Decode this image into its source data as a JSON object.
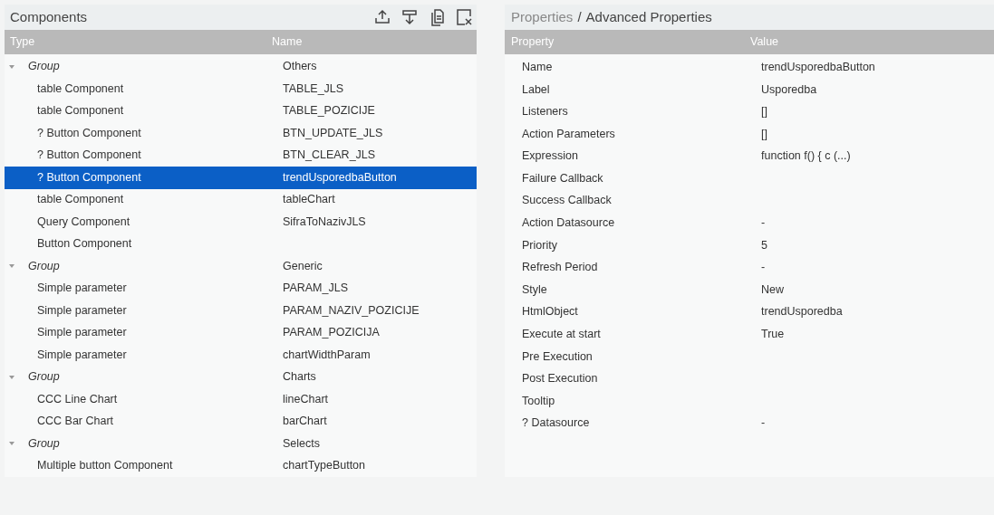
{
  "components": {
    "title": "Components",
    "columns": [
      "Type",
      "Name"
    ],
    "groups": [
      {
        "type": "Group",
        "name": "Others",
        "expanded": true,
        "children": [
          {
            "type": "table Component",
            "name": "TABLE_JLS",
            "selected": false
          },
          {
            "type": "table Component",
            "name": "TABLE_POZICIJE",
            "selected": false
          },
          {
            "type": "? Button Component",
            "name": "BTN_UPDATE_JLS",
            "selected": false
          },
          {
            "type": "? Button Component",
            "name": "BTN_CLEAR_JLS",
            "selected": false
          },
          {
            "type": "? Button Component",
            "name": "trendUsporedbaButton",
            "selected": true
          },
          {
            "type": "table Component",
            "name": "tableChart",
            "selected": false
          },
          {
            "type": "Query Component",
            "name": "SifraToNazivJLS",
            "selected": false
          },
          {
            "type": "Button Component",
            "selected": false
          }
        ]
      },
      {
        "type": "Group",
        "name": "Generic",
        "expanded": true,
        "children": [
          {
            "type": "Simple parameter",
            "name": "PARAM_JLS",
            "selected": false
          },
          {
            "type": "Simple parameter",
            "name": "PARAM_NAZIV_POZICIJE",
            "selected": false
          },
          {
            "type": "Simple parameter",
            "name": "PARAM_POZICIJA",
            "selected": false
          },
          {
            "type": "Simple parameter",
            "name": "chartWidthParam",
            "selected": false
          }
        ]
      },
      {
        "type": "Group",
        "name": "Charts",
        "expanded": true,
        "children": [
          {
            "type": "CCC Line Chart",
            "name": "lineChart",
            "selected": false
          },
          {
            "type": "CCC Bar Chart",
            "name": "barChart",
            "selected": false
          }
        ]
      },
      {
        "type": "Group",
        "name": "Selects",
        "expanded": true,
        "children": [
          {
            "type": "Multiple button Component",
            "name": "chartTypeButton",
            "selected": false
          }
        ]
      }
    ]
  },
  "properties": {
    "breadcrumb": [
      "Properties",
      "Advanced Properties"
    ],
    "separator": "/",
    "columns": [
      "Property",
      "Value"
    ],
    "rows": [
      {
        "property": "Name",
        "value": "trendUsporedbaButton"
      },
      {
        "property": "Label",
        "value": "Usporedba"
      },
      {
        "property": "Listeners",
        "value": "[]"
      },
      {
        "property": "Action Parameters",
        "value": "[]"
      },
      {
        "property": "Expression",
        "value": "function f() { c (...)"
      },
      {
        "property": "Failure Callback"
      },
      {
        "property": "Success Callback"
      },
      {
        "property": "Action Datasource",
        "value": "-"
      },
      {
        "property": "Priority",
        "value": "5"
      },
      {
        "property": "Refresh Period",
        "value": "-"
      },
      {
        "property": "Style",
        "value": "New"
      },
      {
        "property": "HtmlObject",
        "value": "trendUsporedba"
      },
      {
        "property": "Execute at start",
        "value": "True"
      },
      {
        "property": "Pre Execution"
      },
      {
        "property": "Post Execution"
      },
      {
        "property": "Tooltip"
      },
      {
        "property": "? Datasource",
        "value": "-"
      }
    ]
  }
}
